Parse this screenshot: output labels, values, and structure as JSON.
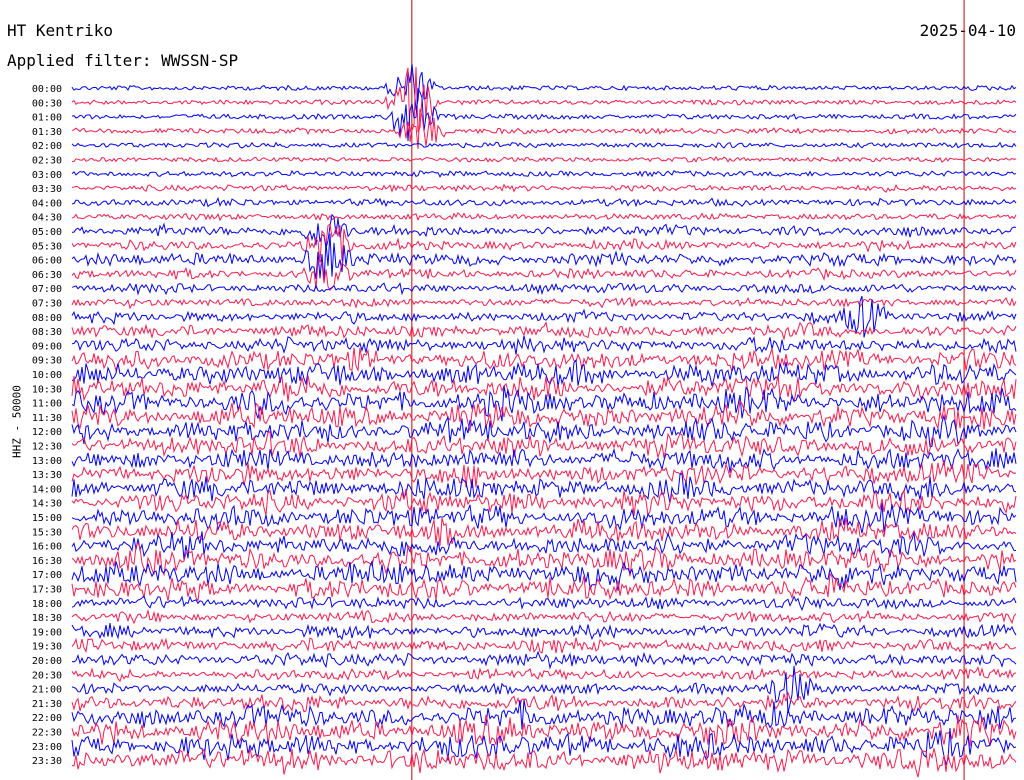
{
  "header": {
    "station": "HT Kentriko",
    "filter": "Applied filter: WWSSN-SP",
    "date": "2025-04-10",
    "channel_label": "HHZ - 50000"
  },
  "colors": {
    "even": "#0000ff",
    "odd": "#ff1a4b",
    "marker": "#cc0000"
  },
  "chart_data": {
    "type": "line",
    "subtype": "helicorder",
    "rows": [
      "00:00",
      "00:30",
      "01:00",
      "01:30",
      "02:00",
      "02:30",
      "03:00",
      "03:30",
      "04:00",
      "04:30",
      "05:00",
      "05:30",
      "06:00",
      "06:30",
      "07:00",
      "07:30",
      "08:00",
      "08:30",
      "09:00",
      "09:30",
      "10:00",
      "10:30",
      "11:00",
      "11:30",
      "12:00",
      "12:30",
      "13:00",
      "13:30",
      "14:00",
      "14:30",
      "15:00",
      "15:30",
      "16:00",
      "16:30",
      "17:00",
      "17:30",
      "18:00",
      "18:30",
      "19:00",
      "19:30",
      "20:00",
      "20:30",
      "21:00",
      "21:30",
      "22:00",
      "22:30",
      "23:00",
      "23:30"
    ],
    "activity": [
      0.08,
      0.08,
      0.1,
      0.12,
      0.1,
      0.08,
      0.12,
      0.15,
      0.2,
      0.15,
      0.35,
      0.3,
      0.45,
      0.3,
      0.3,
      0.25,
      0.35,
      0.45,
      0.55,
      0.8,
      0.9,
      0.95,
      1.0,
      0.95,
      0.9,
      0.85,
      0.85,
      0.8,
      0.85,
      0.85,
      0.9,
      0.85,
      0.9,
      0.95,
      0.95,
      0.85,
      0.4,
      0.35,
      0.45,
      0.45,
      0.5,
      0.35,
      0.35,
      0.6,
      0.95,
      1.0,
      1.0,
      0.95
    ],
    "events": [
      {
        "row": 0,
        "pos": 0.36,
        "amp": 1.8
      },
      {
        "row": 1,
        "pos": 0.36,
        "amp": 3.0
      },
      {
        "row": 2,
        "pos": 0.36,
        "amp": 2.5
      },
      {
        "row": 3,
        "pos": 0.37,
        "amp": 1.5
      },
      {
        "row": 10,
        "pos": 0.27,
        "amp": 1.6
      },
      {
        "row": 11,
        "pos": 0.27,
        "amp": 2.2
      },
      {
        "row": 12,
        "pos": 0.27,
        "amp": 1.8
      },
      {
        "row": 13,
        "pos": 0.27,
        "amp": 1.2
      },
      {
        "row": 16,
        "pos": 0.84,
        "amp": 1.4
      },
      {
        "row": 42,
        "pos": 0.76,
        "amp": 1.6
      }
    ],
    "markers": [
      0.36,
      0.945
    ]
  }
}
